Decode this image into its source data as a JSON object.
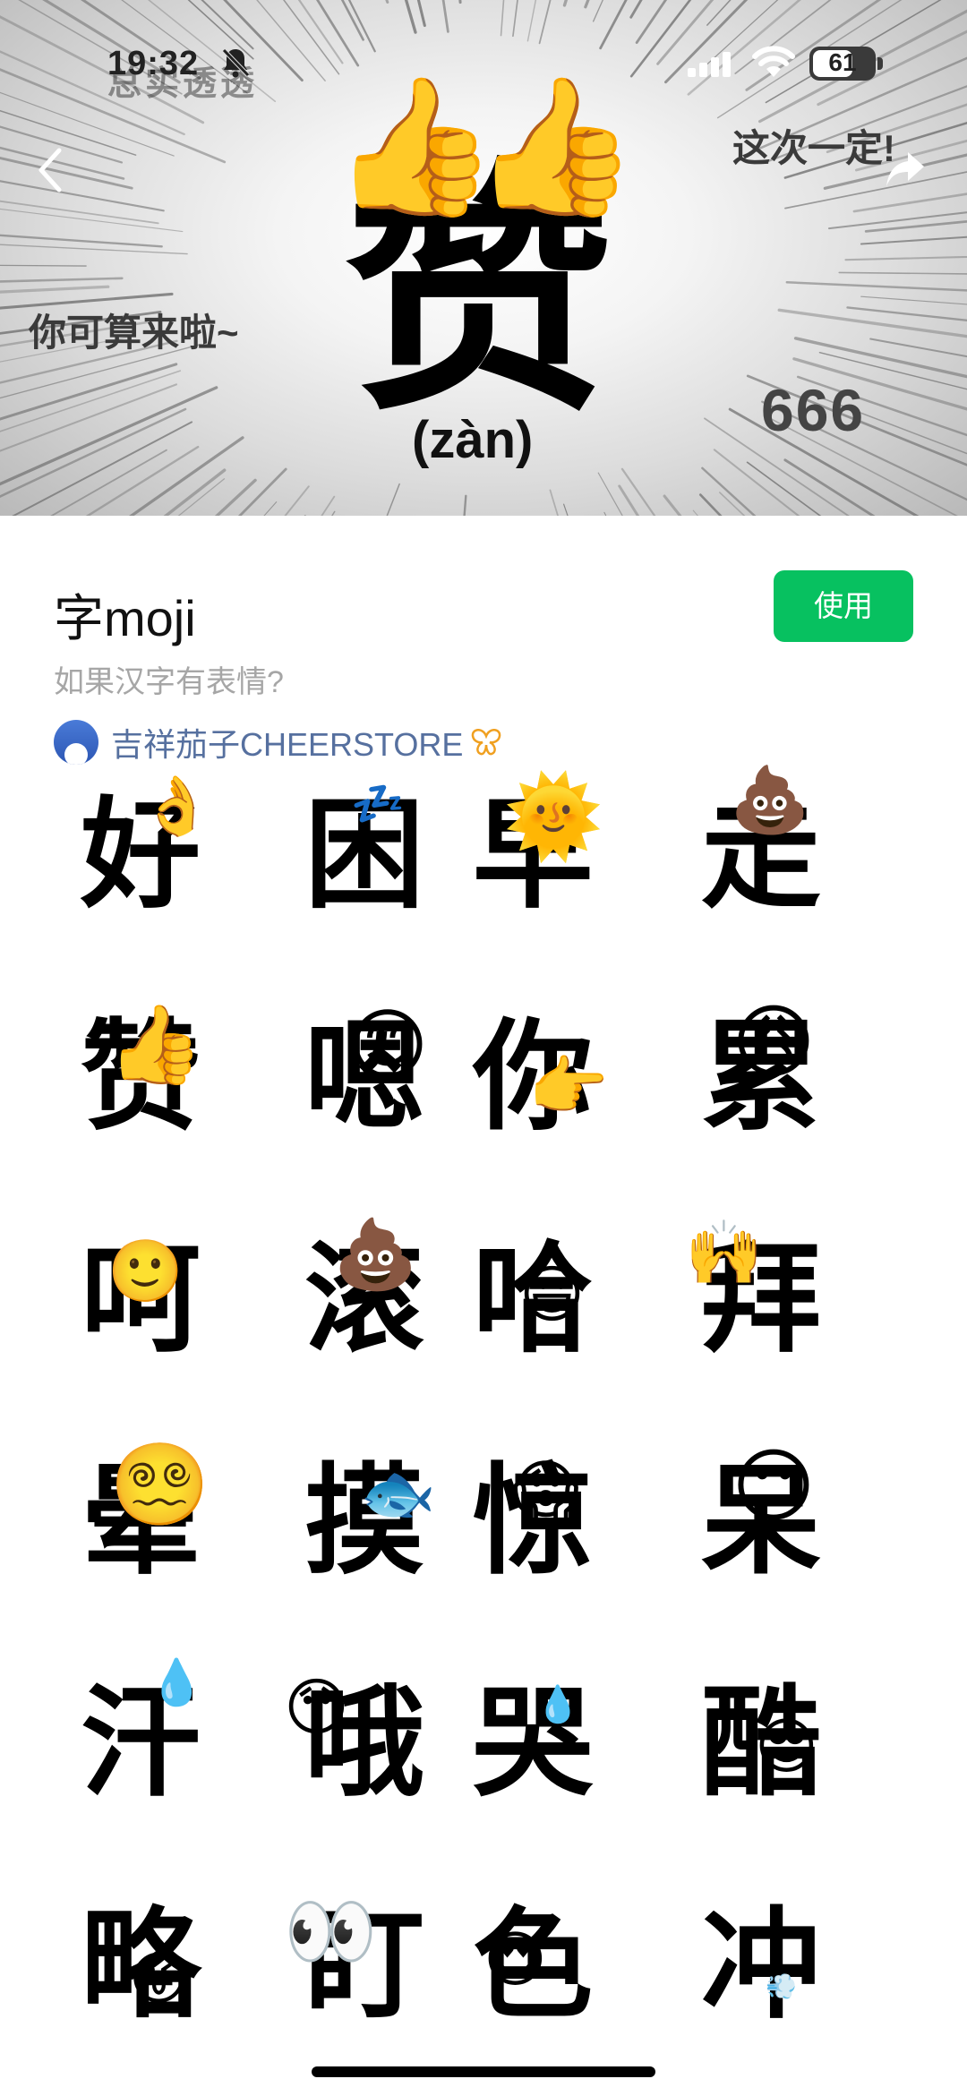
{
  "status": {
    "time": "19:32",
    "battery": "61"
  },
  "banner": {
    "ghost_text": "总实透透",
    "caption_right": "这次一定!",
    "caption_left": "你可算来啦~",
    "caption_number": "666",
    "character": "赞",
    "pinyin": "(zàn)",
    "emoji": "👍👍"
  },
  "pack": {
    "title": "字moji",
    "subtitle": "如果汉字有表情?",
    "author": "吉祥茄子CHEERSTORE",
    "use_label": "使用"
  },
  "grid": [
    {
      "char": "好",
      "emoji": "👌"
    },
    {
      "char": "困",
      "emoji": "💤"
    },
    {
      "char": "早",
      "emoji": "🌞"
    },
    {
      "char": "走",
      "emoji": "💩"
    },
    {
      "char": "赞",
      "emoji": "👍"
    },
    {
      "char": "嗯",
      "emoji": "😊"
    },
    {
      "char": "你",
      "emoji": "👉"
    },
    {
      "char": "累",
      "emoji": "😩"
    },
    {
      "char": "呵",
      "emoji": "🙂"
    },
    {
      "char": "滚",
      "emoji": "💩"
    },
    {
      "char": "哈",
      "emoji": "😃"
    },
    {
      "char": "拜",
      "emoji": "🙌"
    },
    {
      "char": "晕",
      "emoji": "😵‍💫"
    },
    {
      "char": "摸",
      "emoji": "🐟"
    },
    {
      "char": "惊",
      "emoji": "😱"
    },
    {
      "char": "呆",
      "emoji": "😐"
    },
    {
      "char": "汗",
      "emoji": "💧"
    },
    {
      "char": "哦",
      "emoji": "😯"
    },
    {
      "char": "哭",
      "emoji": "💧"
    },
    {
      "char": "酷",
      "emoji": "😎"
    },
    {
      "char": "略",
      "emoji": "😜"
    },
    {
      "char": "盯",
      "emoji": "👀"
    },
    {
      "char": "色",
      "emoji": "😍"
    },
    {
      "char": "冲",
      "emoji": "💨"
    }
  ]
}
